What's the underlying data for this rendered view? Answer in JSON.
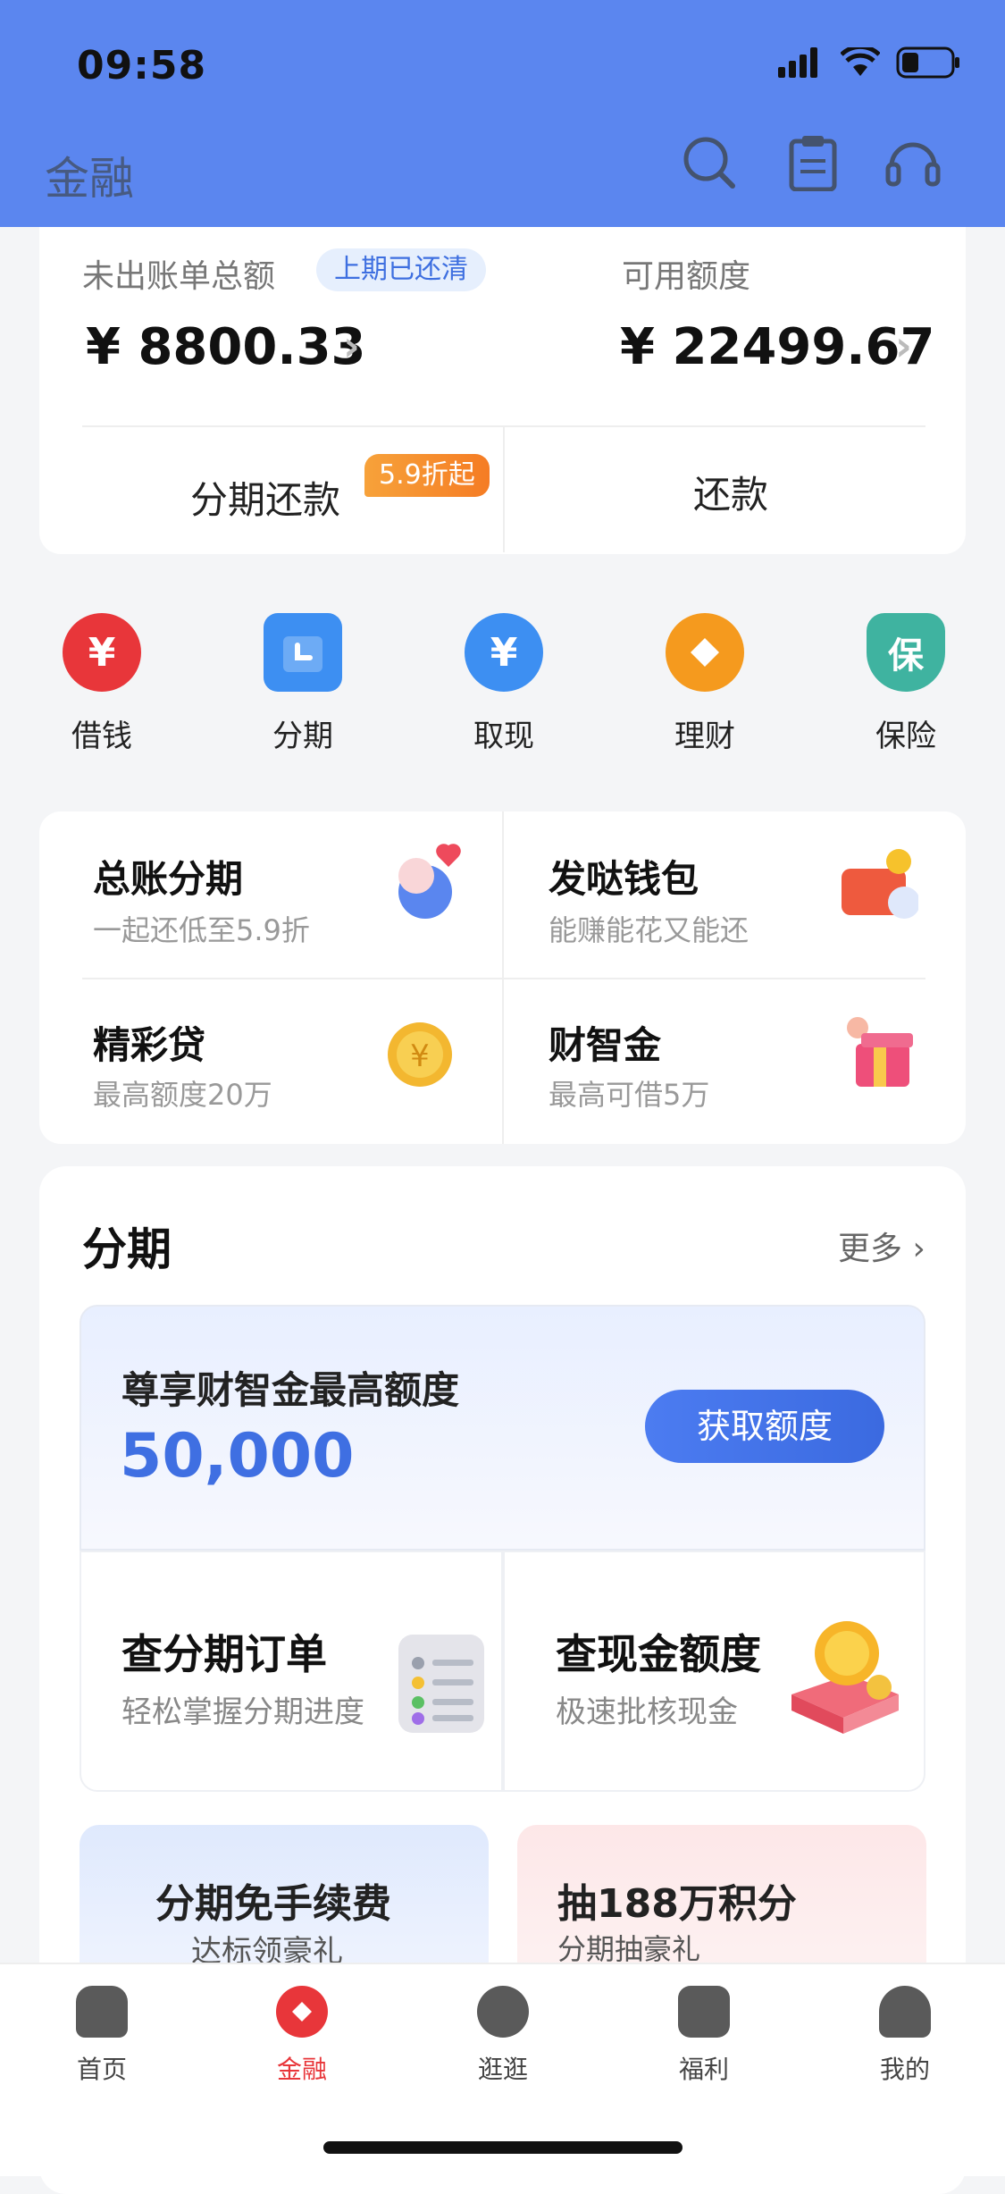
{
  "status": {
    "time": "09:58"
  },
  "header": {
    "title": "金融",
    "icons": [
      "search-icon",
      "clipboard-icon",
      "headset-icon"
    ]
  },
  "bill": {
    "unbilled_label": "未出账单总额",
    "badge": "上期已还清",
    "unbilled_amount": "¥ 8800.33",
    "available_label": "可用额度",
    "available_amount": "¥ 22499.67",
    "installment_repay": "分期还款",
    "discount_tag": "5.9折起",
    "repay": "还款"
  },
  "quick_actions": [
    {
      "label": "借钱",
      "icon": "yuan-icon",
      "color": "#e8363a"
    },
    {
      "label": "分期",
      "icon": "calendar-icon",
      "color": "#3d8ff2"
    },
    {
      "label": "取现",
      "icon": "cash-hand-icon",
      "color": "#3d8ff2"
    },
    {
      "label": "理财",
      "icon": "diamond-icon",
      "color": "#f59a1e"
    },
    {
      "label": "保险",
      "icon": "shield-icon",
      "color": "#3fb3a0"
    }
  ],
  "products": [
    {
      "name": "总账分期",
      "sub": "一起还低至5.9折"
    },
    {
      "name": "发哒钱包",
      "sub": "能赚能花又能还"
    },
    {
      "name": "精彩贷",
      "sub": "最高额度20万"
    },
    {
      "name": "财智金",
      "sub": "最高可借5万"
    }
  ],
  "installment": {
    "title": "分期",
    "more": "更多",
    "promo_text": "尊享财智金最高额度",
    "promo_amount": "50,000",
    "promo_button": "获取额度",
    "order_title": "查分期订单",
    "order_sub": "轻松掌握分期进度",
    "cash_title": "查现金额度",
    "cash_sub": "极速批核现金",
    "promo_left_title": "分期免手续费",
    "promo_left_sub": "达标领豪礼",
    "promo_right_title": "抽188万积分",
    "promo_right_sub": "分期抽豪礼"
  },
  "tabs": [
    {
      "label": "首页",
      "icon": "home-icon"
    },
    {
      "label": "金融",
      "icon": "finance-icon"
    },
    {
      "label": "逛逛",
      "icon": "browse-icon"
    },
    {
      "label": "福利",
      "icon": "gift-icon"
    },
    {
      "label": "我的",
      "icon": "profile-icon"
    }
  ],
  "colors": {
    "header": "#5b86ef",
    "accent": "#3f6fe2",
    "active_tab": "#e8363a"
  }
}
